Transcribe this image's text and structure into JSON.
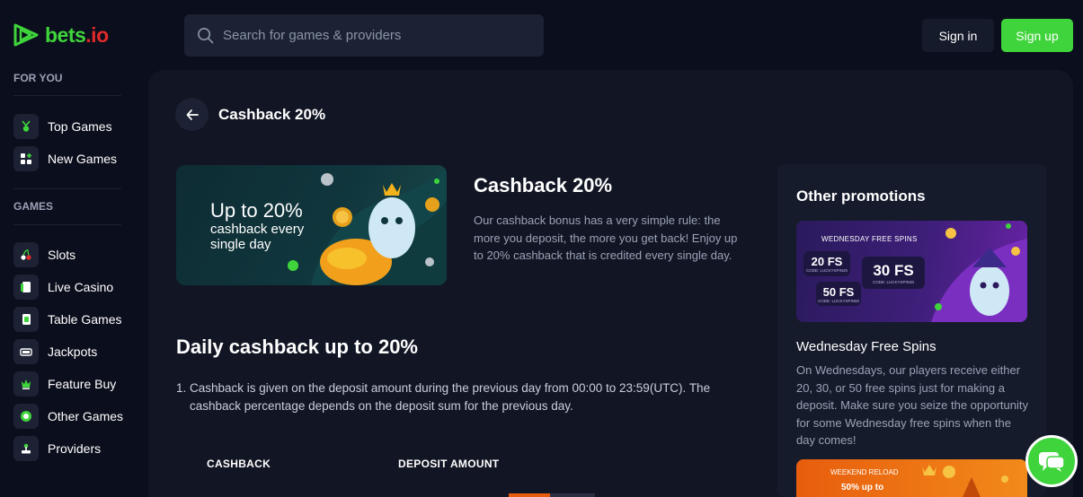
{
  "header": {
    "logo_text_a": "bets",
    "logo_text_b": ".io",
    "search_placeholder": "Search for games & providers",
    "signin_label": "Sign in",
    "signup_label": "Sign up"
  },
  "sidebar": {
    "sections": [
      {
        "title": "FOR YOU",
        "items": [
          {
            "label": "Top Games",
            "icon": "trophy-icon"
          },
          {
            "label": "New Games",
            "icon": "new-games-icon"
          }
        ]
      },
      {
        "title": "GAMES",
        "items": [
          {
            "label": "Slots",
            "icon": "cherries-icon"
          },
          {
            "label": "Live Casino",
            "icon": "live-card-icon"
          },
          {
            "label": "Table Games",
            "icon": "table-card-icon"
          },
          {
            "label": "Jackpots",
            "icon": "jackpot-icon"
          },
          {
            "label": "Feature Buy",
            "icon": "feature-buy-icon"
          },
          {
            "label": "Other Games",
            "icon": "chip-icon"
          },
          {
            "label": "Providers",
            "icon": "joystick-icon"
          }
        ]
      }
    ]
  },
  "main": {
    "page_title": "Cashback 20%",
    "banner": {
      "headline": "Up to 20%",
      "subline": "cashback every single day"
    },
    "promo_title": "Cashback 20%",
    "promo_description": "Our cashback bonus has a very simple rule: the more you deposit, the more you get back! Enjoy up to 20% cashback that is credited every single day.",
    "section_title": "Daily cashback up to 20%",
    "rules": [
      {
        "num": "1.",
        "text": "Cashback is given on the deposit amount during the previous day from 00:00 to 23:59(UTC). The cashback percentage depends on the deposit sum for the previous day."
      }
    ],
    "table_headers": [
      "CASHBACK",
      "DEPOSIT AMOUNT"
    ]
  },
  "other_promotions": {
    "title": "Other promotions",
    "card1": {
      "banner_head": "WEDNESDAY FREE SPINS",
      "chips": [
        {
          "amount": "20 FS",
          "code": "CODE: LUCKYSPIN20"
        },
        {
          "amount": "30 FS",
          "code": "CODE: LUCKYSPIN30"
        },
        {
          "amount": "50 FS",
          "code": "CODE: LUCKYSPIN50"
        }
      ],
      "name": "Wednesday Free Spins",
      "description": "On Wednesdays, our players receive either 20, 30, or 50 free spins just for making a deposit. Make sure you seize the opportunity for some Wednesday free spins when the day comes!"
    },
    "card2": {
      "banner_head": "WEEKEND RELOAD",
      "banner_sub": "50% up to"
    }
  },
  "colors": {
    "brand_green": "#3fd43b",
    "brand_red": "#e02a2a",
    "page_bg": "#0b0e1c",
    "panel_bg": "#121624"
  }
}
